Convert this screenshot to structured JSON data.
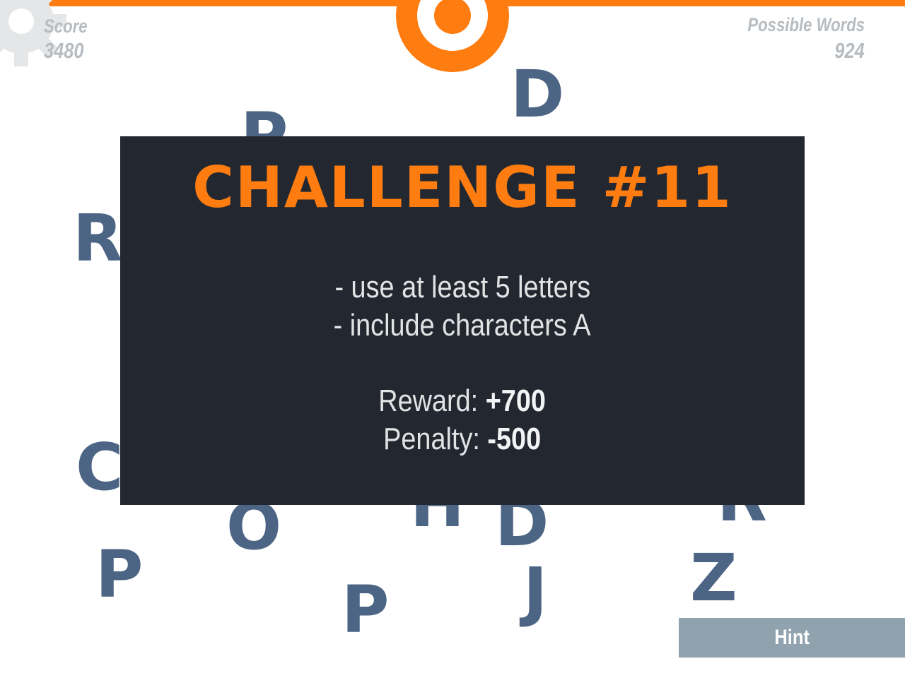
{
  "hud": {
    "score_label": "Score",
    "score_value": "3480",
    "words_label": "Possible Words",
    "words_value": "924"
  },
  "tiles": {
    "t1": "D",
    "t2": "P",
    "t3": "R",
    "t4": "C",
    "t5": "O",
    "t6": "H",
    "t7": "D",
    "t8": "R",
    "t9": "P",
    "t10": "P",
    "t11": "J",
    "t12": "Z"
  },
  "challenge": {
    "title": "CHALLENGE #11",
    "requirement_1": "- use at least 5 letters",
    "requirement_2": "- include characters A",
    "reward_label": "Reward: ",
    "reward_value": "+700",
    "penalty_label": "Penalty: ",
    "penalty_value": "-500"
  },
  "buttons": {
    "hint_label": "Hint"
  },
  "colors": {
    "accent": "#ff7d10",
    "tile": "#4d6584",
    "modal_bg": "#232830",
    "hud_text": "#b7bcc1",
    "hint_bg": "#8fa2ae"
  }
}
